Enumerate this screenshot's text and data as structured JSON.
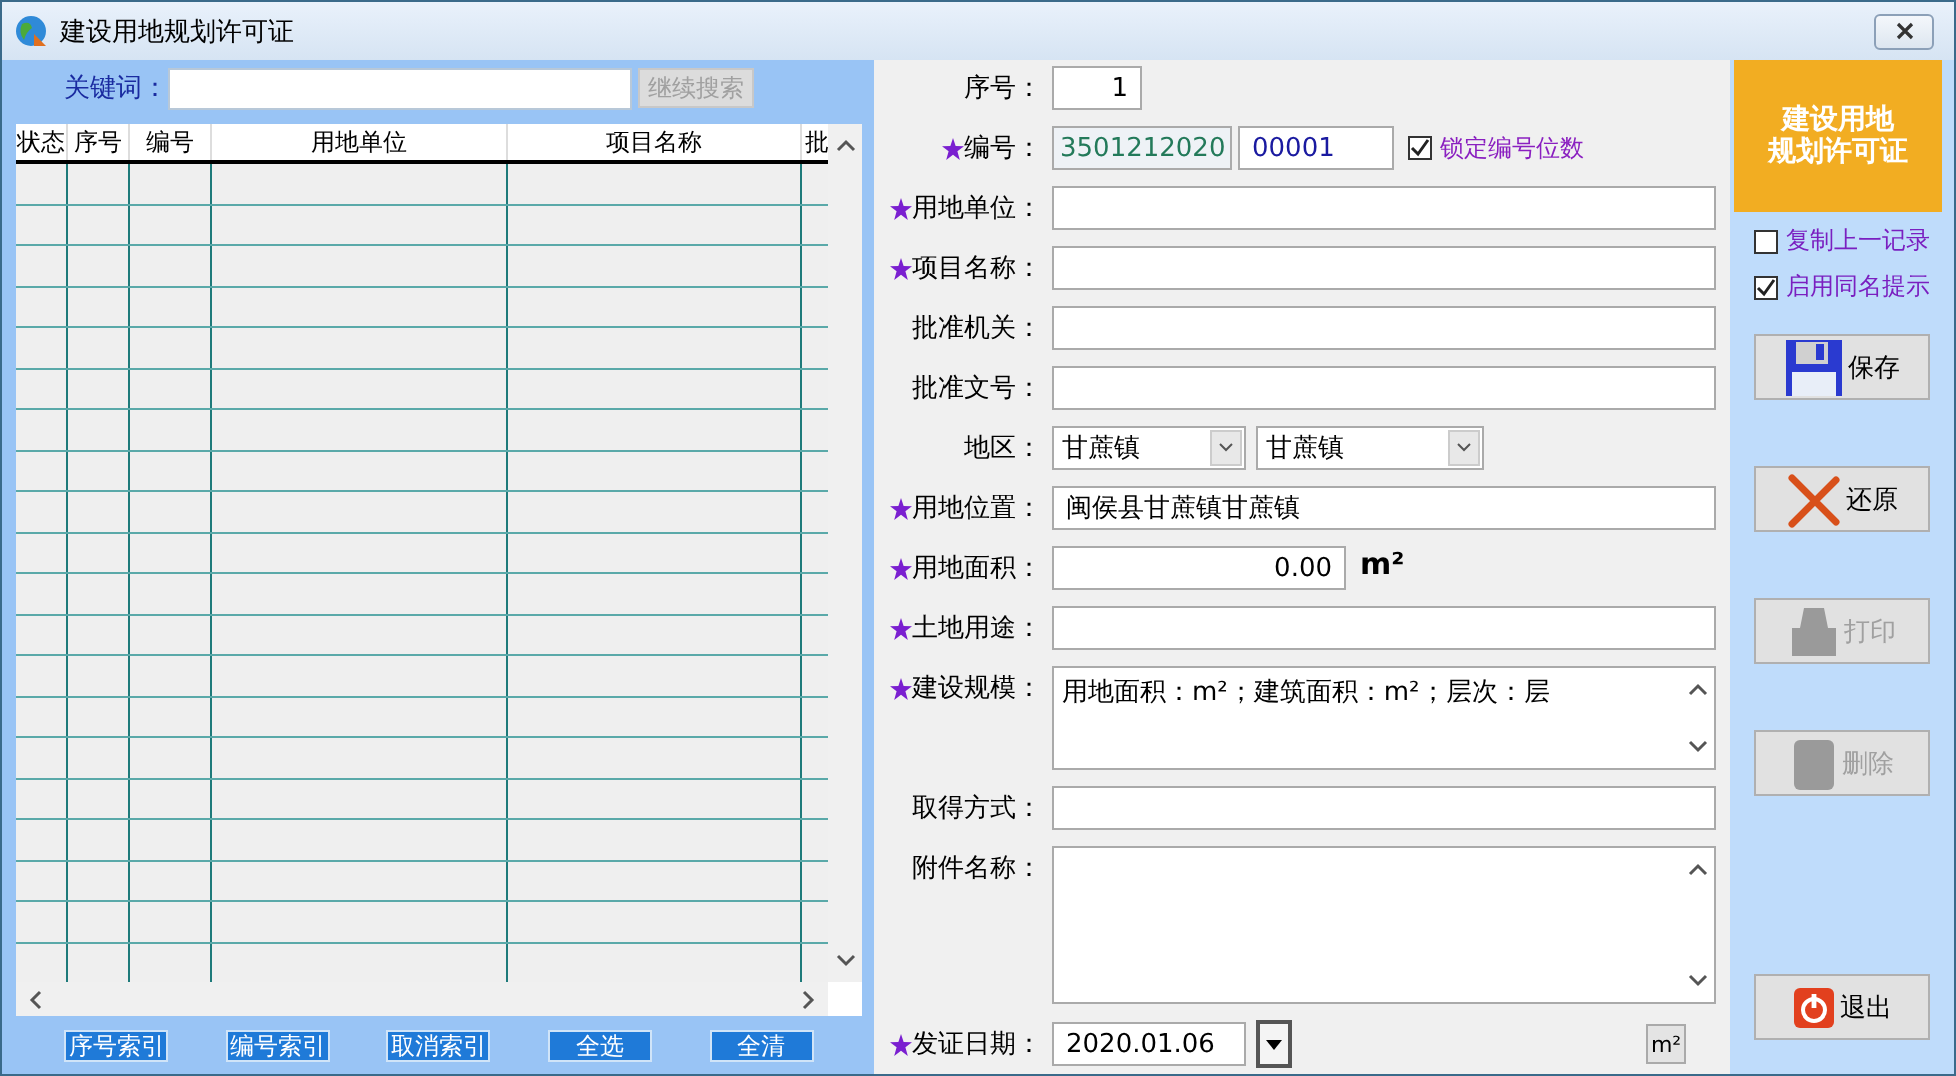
{
  "window": {
    "title": "建设用地规划许可证"
  },
  "search": {
    "label": "关键词：",
    "button": "继续搜索",
    "button_disabled": true
  },
  "table": {
    "columns": [
      "状态",
      "序号",
      "编号",
      "用地单位",
      "项目名称",
      "批"
    ]
  },
  "index_buttons": [
    "序号索引",
    "编号索引",
    "取消索引",
    "全选",
    "全清"
  ],
  "form": {
    "fields": [
      {
        "kind": "number",
        "label": "序号：",
        "required": false,
        "value": "1"
      },
      {
        "kind": "code",
        "label": "编号：",
        "required": true,
        "prefix": "3501212020",
        "value": "00001",
        "checkbox": {
          "label": "锁定编号位数",
          "checked": true
        }
      },
      {
        "kind": "text",
        "label": "用地单位：",
        "required": true
      },
      {
        "kind": "text",
        "label": "项目名称：",
        "required": true
      },
      {
        "kind": "text",
        "label": "批准机关：",
        "required": false
      },
      {
        "kind": "text",
        "label": "批准文号：",
        "required": false
      },
      {
        "kind": "selects",
        "label": "地区：",
        "required": false,
        "values": [
          "甘蔗镇",
          "甘蔗镇"
        ]
      },
      {
        "kind": "text",
        "label": "用地位置：",
        "required": true,
        "value": "闽侯县甘蔗镇甘蔗镇"
      },
      {
        "kind": "area",
        "label": "用地面积：",
        "required": true,
        "value": "0.00",
        "unit": "m²"
      },
      {
        "kind": "text",
        "label": "土地用途：",
        "required": true
      },
      {
        "kind": "memo",
        "label": "建设规模：",
        "required": true,
        "value": "用地面积：m²；建筑面积：m²；层次：层"
      },
      {
        "kind": "text",
        "label": "取得方式：",
        "required": false
      },
      {
        "kind": "notes",
        "label": "附件名称：",
        "required": false
      },
      {
        "kind": "date",
        "label": "发证日期：",
        "required": true,
        "value": "2020.01.06"
      }
    ],
    "unit_button": "m²"
  },
  "side": {
    "logo_lines": [
      "建设用地",
      "规划许可证"
    ],
    "options": [
      {
        "label": "复制上一记录",
        "checked": false
      },
      {
        "label": "启用同名提示",
        "checked": true
      }
    ],
    "actions": [
      {
        "kind": "save",
        "label": "保存",
        "disabled": false
      },
      {
        "kind": "undo",
        "label": "还原",
        "disabled": false
      },
      {
        "kind": "print",
        "label": "打印",
        "disabled": true
      },
      {
        "kind": "delete",
        "label": "删除",
        "disabled": true
      },
      {
        "kind": "exit",
        "label": "退出",
        "disabled": false
      }
    ]
  }
}
